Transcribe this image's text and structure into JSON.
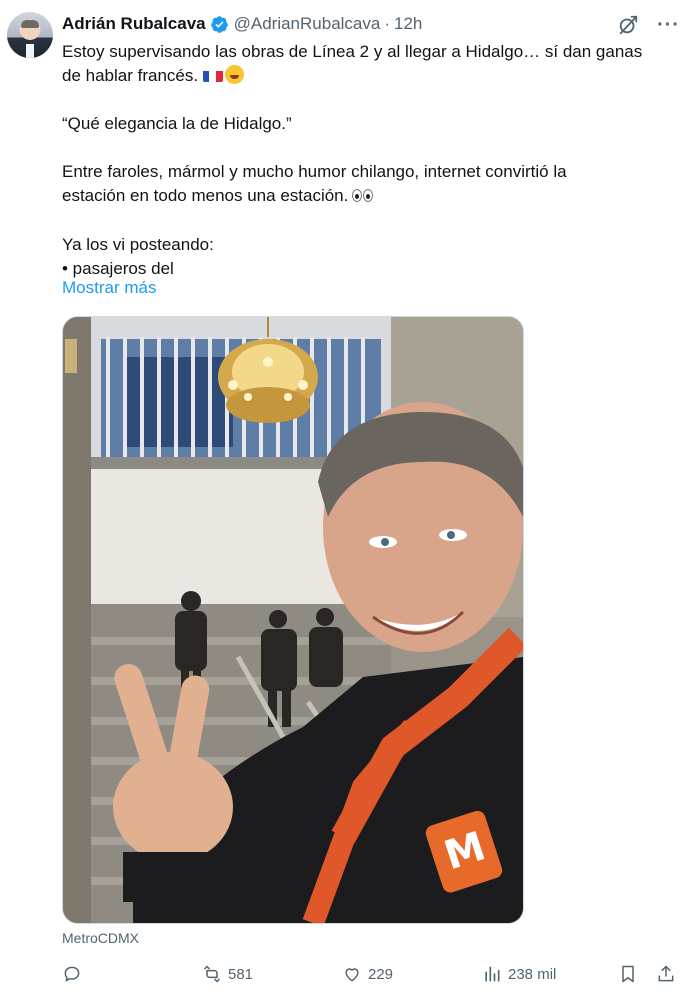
{
  "tweet": {
    "author_name": "Adrián Rubalcava",
    "handle": "@AdrianRubalcava",
    "separator": "·",
    "time": "12h",
    "more_label": "···",
    "text": {
      "line1": "Estoy supervisando las obras de Línea 2 y al llegar a Hidalgo… sí dan ganas",
      "line2": "de hablar francés.",
      "quote": "“Qué elegancia la de Hidalgo.”",
      "para3_line1": "Entre faroles, mármol y mucho humor chilango, internet convirtió la",
      "para3_line2": "estación en todo menos una estación.",
      "para4_line1": "Ya los vi posteando:",
      "para4_line2": "• pasajeros del"
    },
    "show_more": "Mostrar más",
    "media_caption": "MetroCDMX",
    "icons": {
      "verified": "verified-badge-icon",
      "grok": "grok-icon",
      "flag": "france-flag-emoji",
      "laugh": "tears-of-joy-emoji",
      "eyes": "eyes-emoji"
    },
    "stats": {
      "replies": "",
      "retweets": "581",
      "likes": "229",
      "views": "238 mil"
    },
    "colors": {
      "link": "#1d9bf0",
      "verified": "#1d9bf0",
      "secondary_text": "#536471"
    }
  }
}
